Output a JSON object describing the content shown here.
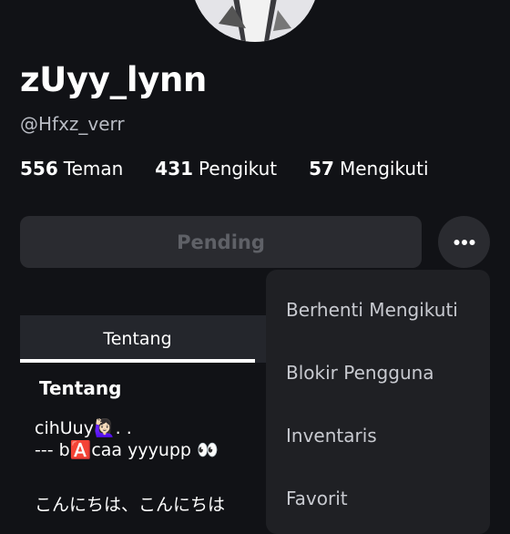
{
  "profile": {
    "display_name": "zUyy_lynn",
    "username": "@Hfxz_verr"
  },
  "stats": [
    {
      "count": "556",
      "label": "Teman"
    },
    {
      "count": "431",
      "label": "Pengikut"
    },
    {
      "count": "57",
      "label": "Mengikuti"
    }
  ],
  "actions": {
    "pending_label": "Pending"
  },
  "tabs": [
    {
      "label": "Tentang"
    }
  ],
  "about": {
    "heading": "Tentang",
    "bio_line1": "cihUuy🙋🏻‍♀️. .",
    "bio_line2": "--- b🅰️caa yyyupp 👀",
    "bio_line3": "こんにちは、こんにちは"
  },
  "menu": {
    "items": [
      {
        "label": "Berhenti Mengikuti"
      },
      {
        "label": "Blokir Pengguna"
      },
      {
        "label": "Inventaris"
      },
      {
        "label": "Favorit"
      }
    ]
  },
  "colors": {
    "background": "#111216",
    "button_bg": "#2a2b30",
    "menu_bg": "#1f2024"
  }
}
